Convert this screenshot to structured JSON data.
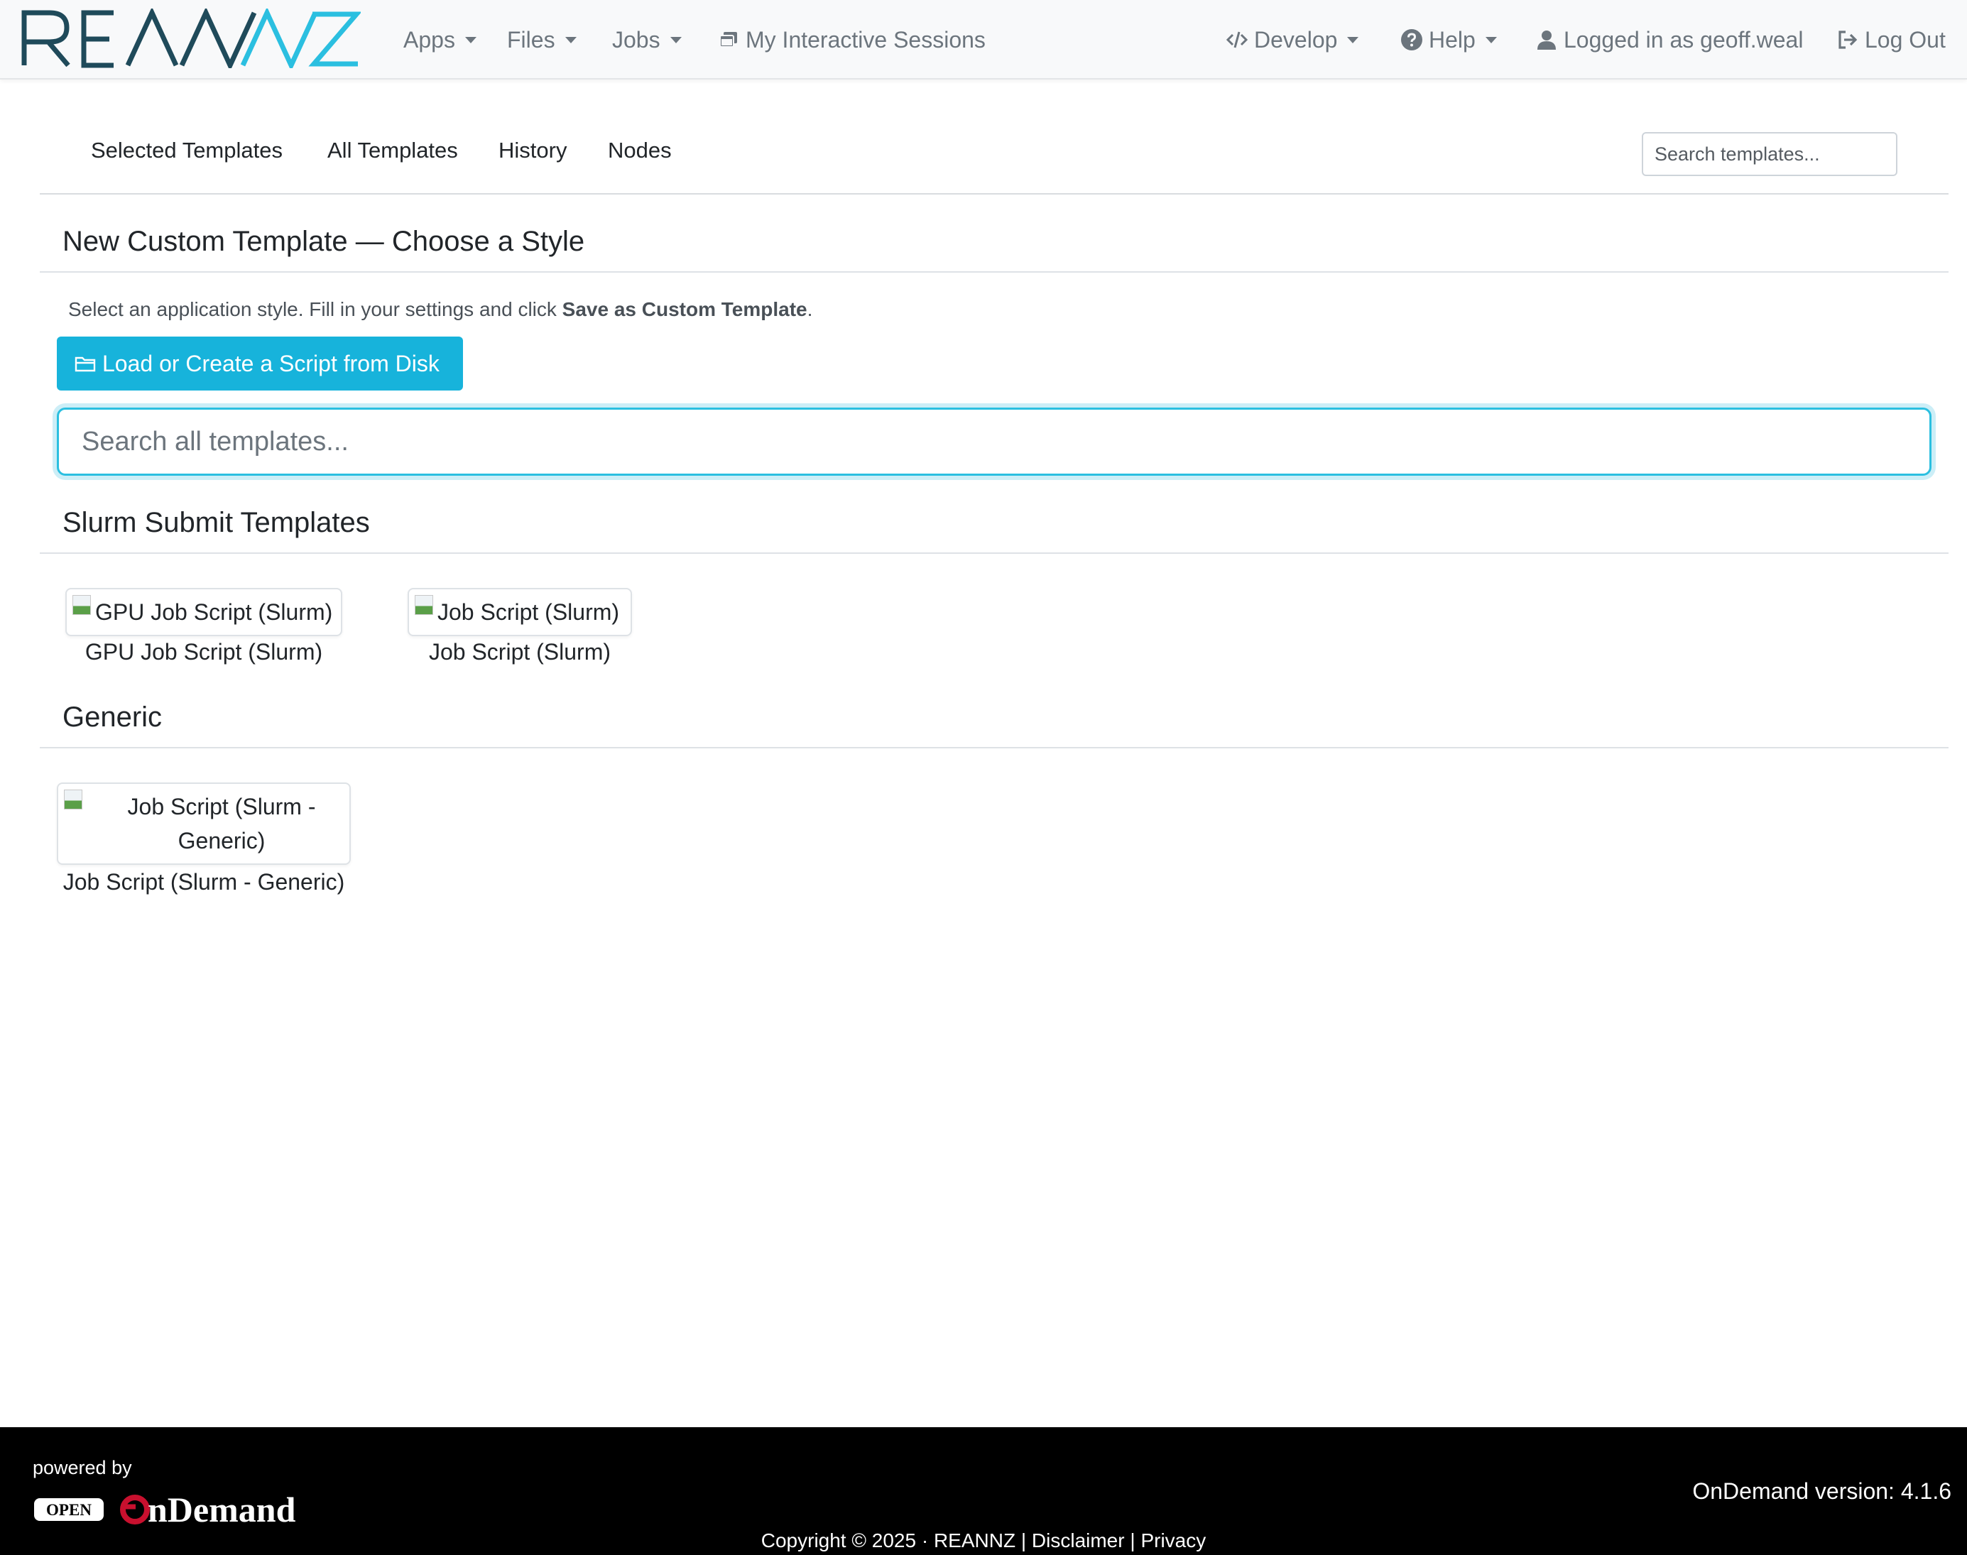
{
  "brand": {
    "logo_text": "REANNZ"
  },
  "nav": {
    "apps": "Apps",
    "files": "Files",
    "jobs": "Jobs",
    "sessions": "My Interactive Sessions",
    "develop": "Develop",
    "help": "Help",
    "user": "Logged in as geoff.weal",
    "logout": "Log Out"
  },
  "tabs": [
    "Selected Templates",
    "All Templates",
    "History",
    "Nodes"
  ],
  "top_search": {
    "placeholder": "Search templates..."
  },
  "page": {
    "title": "New Custom Template — Choose a Style",
    "intro_prefix": "Select an application style. Fill in your settings and click ",
    "intro_bold": "Save as Custom Template",
    "intro_suffix": ".",
    "load_button": "Load or Create a Script from Disk",
    "search_placeholder": "Search all templates..."
  },
  "sections": [
    {
      "title": "Slurm Submit Templates",
      "templates": [
        {
          "alt": "GPU Job Script (Slurm)",
          "caption": "GPU Job Script (Slurm)"
        },
        {
          "alt": "Job Script (Slurm)",
          "caption": "Job Script (Slurm)"
        }
      ]
    },
    {
      "title": "Generic",
      "templates": [
        {
          "alt": "Job Script (Slurm - Generic)",
          "caption": "Job Script (Slurm - Generic)"
        }
      ]
    }
  ],
  "footer": {
    "powered_by": "powered by",
    "logo_open": "OPEN",
    "logo_ondemand": "OnDemand",
    "version": "OnDemand version: 4.1.6",
    "copyright": "Copyright © 2025 · REANNZ",
    "sep": "|",
    "disclaimer": "Disclaimer",
    "privacy": "Privacy"
  },
  "colors": {
    "brand_dark": "#1f4a5a",
    "brand_light": "#2bbfe0",
    "button": "#17b3db",
    "footer_bg": "#000000",
    "ondemand_red": "#c8102e"
  },
  "icons": {
    "sessions": "sessions-icon",
    "develop": "code-icon",
    "help": "question-circle-icon",
    "user": "user-icon",
    "logout": "sign-out-icon",
    "load": "folder-open-icon"
  }
}
